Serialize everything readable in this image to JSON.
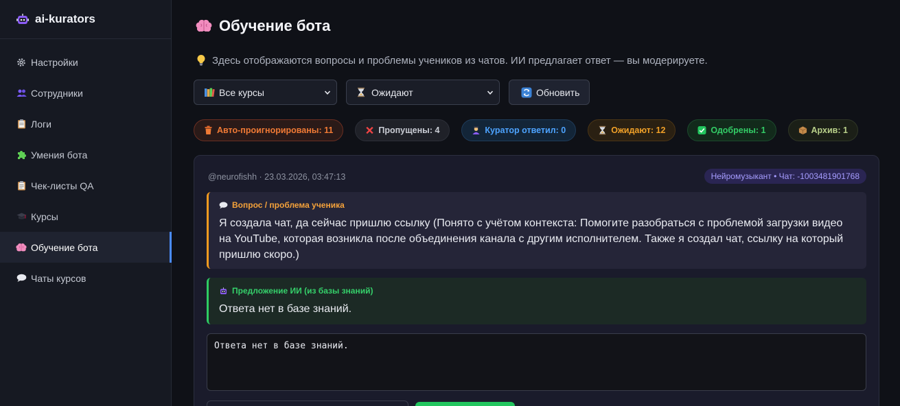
{
  "brand": {
    "name": "ai-kurators"
  },
  "sidebar": {
    "items": [
      {
        "label": "Настройки",
        "icon": "gear-icon"
      },
      {
        "label": "Сотрудники",
        "icon": "people-icon"
      },
      {
        "label": "Логи",
        "icon": "clipboard-icon"
      },
      {
        "label": "Умения бота",
        "icon": "puzzle-icon"
      },
      {
        "label": "Чек-листы QA",
        "icon": "checklist-icon"
      },
      {
        "label": "Курсы",
        "icon": "graduation-cap-icon"
      },
      {
        "label": "Обучение бота",
        "icon": "brain-icon",
        "active": true
      },
      {
        "label": "Чаты курсов",
        "icon": "speech-bubble-icon"
      }
    ]
  },
  "page": {
    "title": "Обучение бота",
    "hint": "Здесь отображаются вопросы и проблемы учеников из чатов. ИИ предлагает ответ — вы модерируете."
  },
  "controls": {
    "course_select": "Все курсы",
    "status_select": "Ожидают",
    "refresh_label": "Обновить"
  },
  "pills": [
    {
      "label": "Авто-проигнорированы: 11",
      "icon": "trash-icon",
      "color": "#f07a35"
    },
    {
      "label": "Пропущены: 4",
      "icon": "cross-icon",
      "color": "#c9ccd4"
    },
    {
      "label": "Куратор ответил: 0",
      "icon": "curator-icon",
      "color": "#4da3ff"
    },
    {
      "label": "Ожидают: 12",
      "icon": "hourglass-icon",
      "color": "#f0a028"
    },
    {
      "label": "Одобрены: 1",
      "icon": "check-icon",
      "color": "#33cc66"
    },
    {
      "label": "Архив: 1",
      "icon": "box-icon",
      "color": "#b9d08a"
    }
  ],
  "card": {
    "meta": "@neurofishh · 23.03.2026, 03:47:13",
    "chat_badge": "Нейромузыкант • Чат: -1003481901768",
    "question_label": "Вопрос / проблема ученика",
    "question_text": "Я создала чат, да сейчас пришлю ссылку (Понято с учётом контекста: Помогите разобраться с проблемой загрузки видео на YouTube, которая возникла после объединения канала с другим исполнителем. Также я создал чат, ссылку на который пришлю скоро.)",
    "ai_label": "Предложение ИИ (из базы знаний)",
    "ai_text": "Ответа нет в базе знаний.",
    "answer_value": "Ответа нет в базе знаний."
  }
}
